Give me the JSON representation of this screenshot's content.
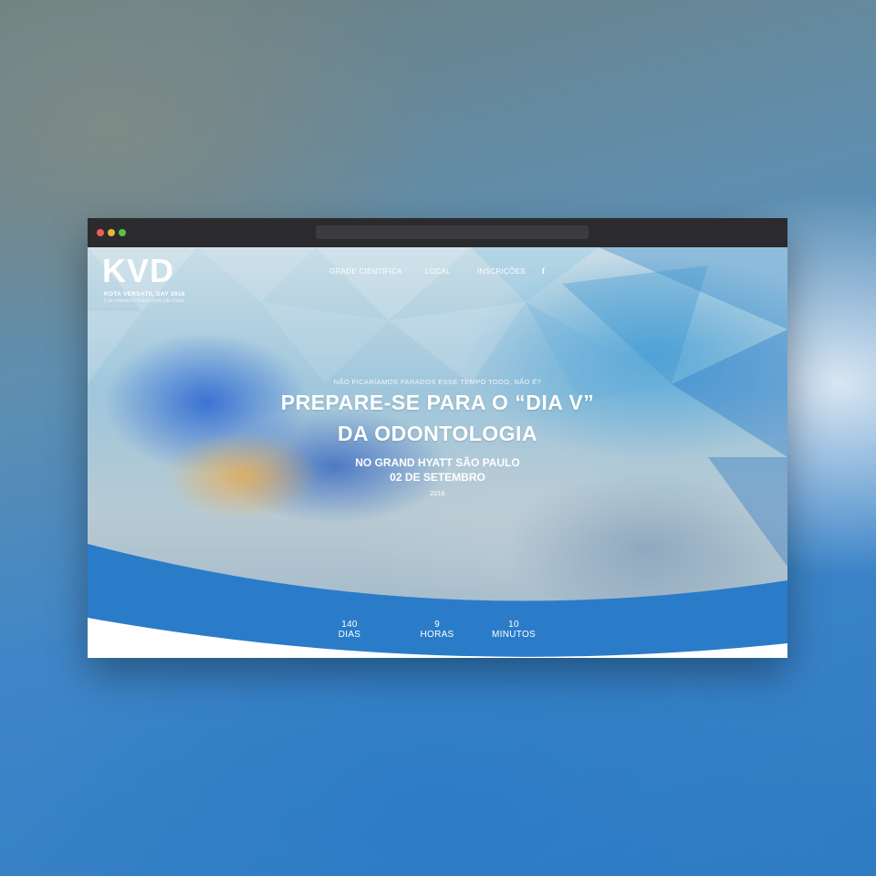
{
  "colors": {
    "brand_blue": "#2a7cc9",
    "text_white": "#ffffff",
    "titlebar": "#2b2b2d"
  },
  "window": {
    "controls": [
      "close",
      "minimize",
      "zoom"
    ]
  },
  "logo": {
    "mark": "KVD",
    "line1": "KOTA VERSATIL DAY 2016",
    "line2": "2 de setembro | Grand Hyatt São Paulo"
  },
  "nav": {
    "items": [
      {
        "label": "GRADE CIENTÍFICA"
      },
      {
        "label": "LOCAL"
      },
      {
        "label": "INSCRIÇÕES"
      }
    ],
    "facebook_icon": "f"
  },
  "hero": {
    "kicker": "NÃO FICARÍAMOS PARADOS ESSE TEMPO TODO, NÃO É?",
    "headline_line1": "PREPARE-SE PARA O “DIA V”",
    "headline_line2": "DA ODONTOLOGIA",
    "venue": "NO GRAND HYATT SÃO PAULO",
    "date": "02 DE SETEMBRO",
    "year": "2016"
  },
  "countdown": [
    {
      "value": "140",
      "unit": "DIAS"
    },
    {
      "value": "9",
      "unit": "HORAS"
    },
    {
      "value": "10",
      "unit": "MINUTOS"
    }
  ]
}
